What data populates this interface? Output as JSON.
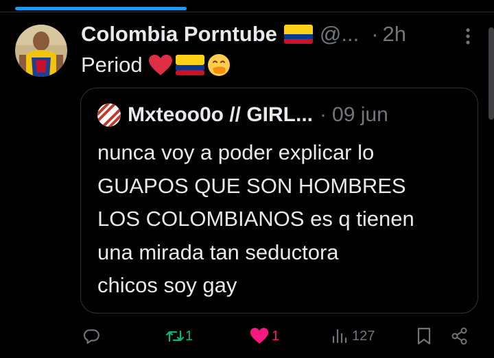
{
  "tweet": {
    "author_name": "Colombia Porntube",
    "handle": "@...",
    "separator": "·",
    "time": "2h",
    "text": "Period",
    "emojis": [
      "red-heart",
      "colombia-flag",
      "face-with-hand-over-mouth"
    ]
  },
  "quote": {
    "author_name": "Mxteoo0o // GIRL...",
    "separator": "·",
    "date": "09 jun",
    "lines": [
      "nunca voy a poder explicar lo",
      "GUAPOS QUE SON HOMBRES",
      "LOS COLOMBIANOS es q tienen",
      "una mirada tan seductora",
      "chicos soy gay"
    ]
  },
  "actions": {
    "reply_count": "",
    "retweet_count": "1",
    "like_count": "1",
    "views_count": "127"
  },
  "colors": {
    "background": "#000000",
    "text": "#e7e9ea",
    "secondary": "#71767b",
    "border": "#2f3336",
    "accent": "#1d9bf0",
    "retweet": "#00ba7c",
    "like": "#f91880"
  }
}
